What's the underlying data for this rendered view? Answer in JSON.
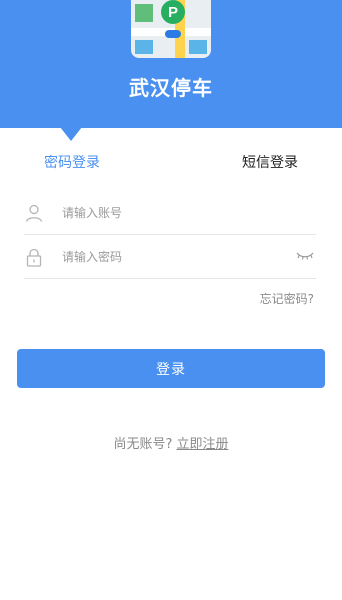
{
  "app": {
    "title": "武汉停车",
    "logo_pin_letter": "P"
  },
  "tabs": {
    "password_login": "密码登录",
    "sms_login": "短信登录",
    "active": "password_login"
  },
  "form": {
    "account_placeholder": "请输入账号",
    "account_value": "",
    "password_placeholder": "请输入密码",
    "password_value": "",
    "account_icon": "user-icon",
    "password_icon": "lock-icon",
    "password_visibility_icon": "eye-closed-icon"
  },
  "links": {
    "forgot_password": "忘记密码?"
  },
  "login_button": "登录",
  "register": {
    "prompt": "尚无账号?",
    "link": "立即注册"
  },
  "colors": {
    "brand": "#4a90f0",
    "background": "#ffffff",
    "muted_text": "#8a8a8a",
    "divider": "#e6e6e6"
  }
}
